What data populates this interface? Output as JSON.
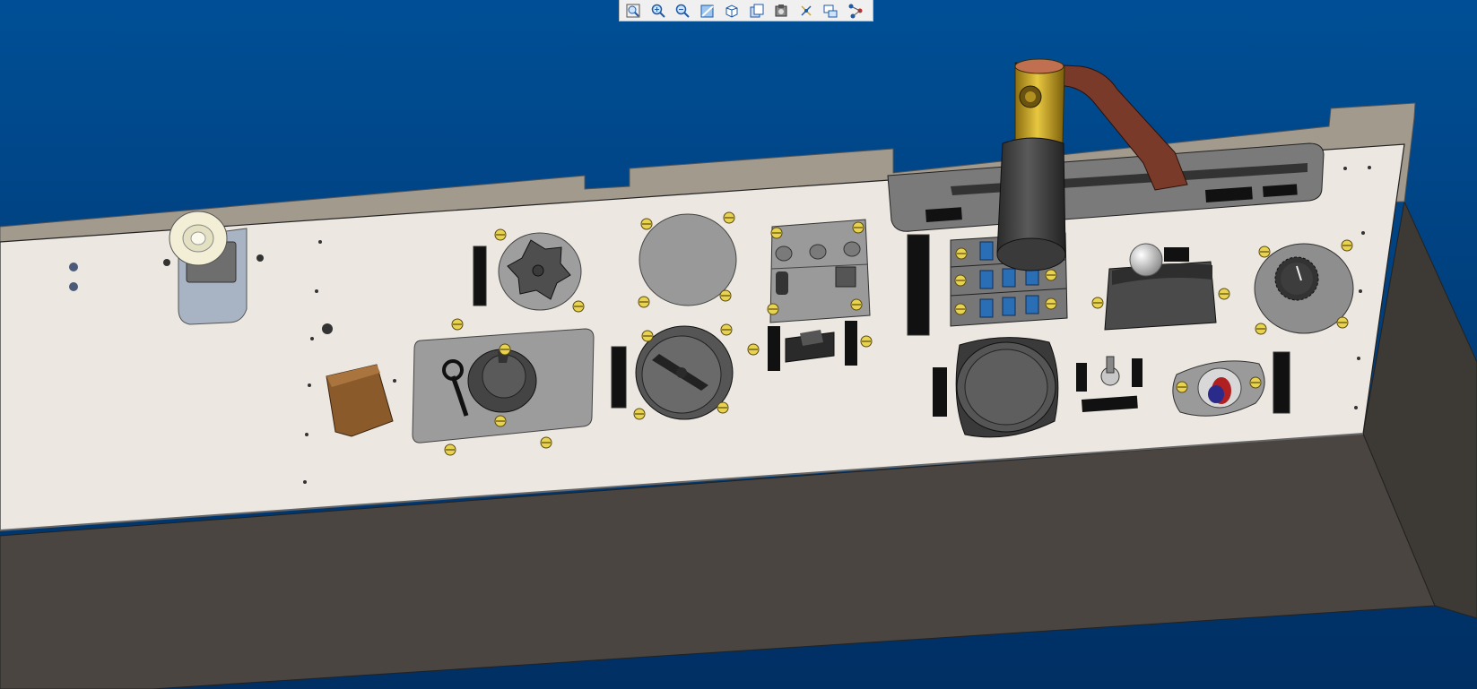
{
  "window": {
    "background_top": "#004f96",
    "background_bottom": "#002f63"
  },
  "toolbar": {
    "buttons": [
      {
        "name": "fit-all-button",
        "icon": "fit-all-icon"
      },
      {
        "name": "zoom-in-button",
        "icon": "zoom-in-icon"
      },
      {
        "name": "zoom-out-button",
        "icon": "zoom-out-icon"
      },
      {
        "name": "normal-view-button",
        "icon": "normal-view-icon"
      },
      {
        "name": "view-mode-button",
        "icon": "cube-view-icon"
      },
      {
        "name": "render-style-button",
        "icon": "render-style-icon"
      },
      {
        "name": "hide-show-button",
        "icon": "hide-show-icon"
      },
      {
        "name": "compass-button",
        "icon": "compass-icon"
      },
      {
        "name": "capture-button",
        "icon": "capture-icon"
      },
      {
        "name": "tree-structure-button",
        "icon": "tree-structure-icon"
      }
    ]
  },
  "model": {
    "panel_color": "#ece8e1",
    "box_color": "#4a4540",
    "rim_color": "#a39a8e",
    "screw_color": "#e8d350",
    "handle_gold": "#c9a522",
    "strap_color": "#7a3a2a",
    "toggle_cap_color": "#8b5a2b",
    "indicator_blue": "#2a6fb5"
  }
}
